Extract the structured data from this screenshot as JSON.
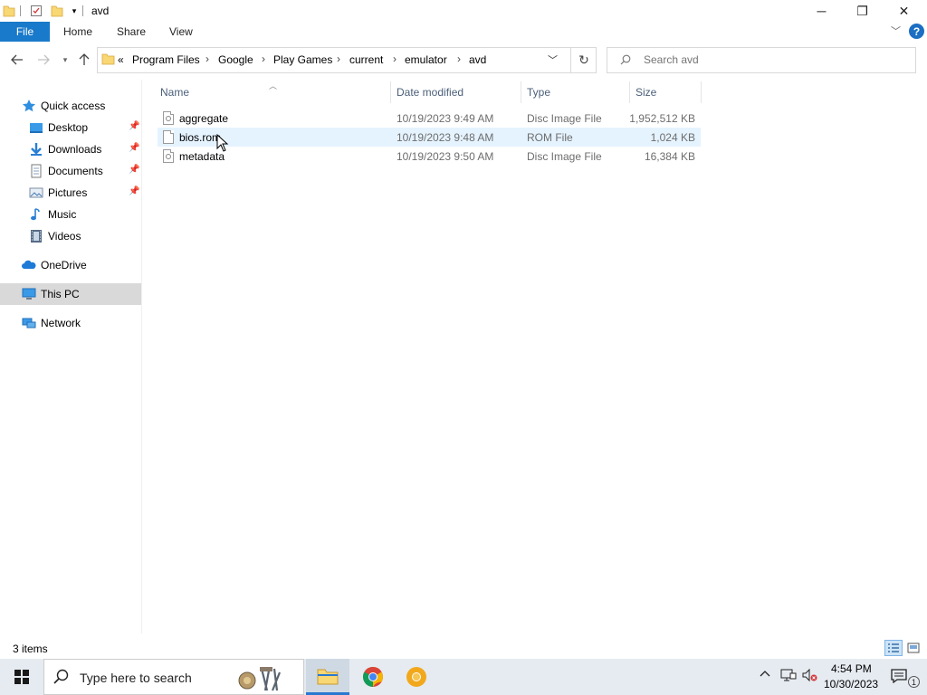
{
  "window": {
    "title": "avd",
    "controls": {
      "minimize": "─",
      "restore": "❐",
      "close": "✕"
    }
  },
  "ribbon": {
    "file": "File",
    "tabs": [
      "Home",
      "Share",
      "View"
    ],
    "help": "?"
  },
  "address": {
    "overflow": "«",
    "crumbs": [
      "Program Files",
      "Google",
      "Play Games",
      "current",
      "emulator",
      "avd"
    ],
    "separator": "›"
  },
  "search": {
    "placeholder": "Search avd"
  },
  "sidebar": {
    "items": [
      {
        "label": "Quick access",
        "icon": "star-icon",
        "pinned": false
      },
      {
        "label": "Desktop",
        "icon": "desktop-icon",
        "pinned": true
      },
      {
        "label": "Downloads",
        "icon": "downloads-icon",
        "pinned": true
      },
      {
        "label": "Documents",
        "icon": "documents-icon",
        "pinned": true
      },
      {
        "label": "Pictures",
        "icon": "pictures-icon",
        "pinned": true
      },
      {
        "label": "Music",
        "icon": "music-icon",
        "pinned": false
      },
      {
        "label": "Videos",
        "icon": "videos-icon",
        "pinned": false
      },
      {
        "label": "OneDrive",
        "icon": "cloud-icon",
        "pinned": false
      },
      {
        "label": "This PC",
        "icon": "computer-icon",
        "pinned": false,
        "selected": true
      },
      {
        "label": "Network",
        "icon": "network-icon",
        "pinned": false
      }
    ]
  },
  "columns": {
    "name": "Name",
    "date": "Date modified",
    "type": "Type",
    "size": "Size"
  },
  "files": [
    {
      "name": "aggregate",
      "date": "10/19/2023 9:49 AM",
      "type": "Disc Image File",
      "size": "1,952,512 KB"
    },
    {
      "name": "bios.rom",
      "date": "10/19/2023 9:48 AM",
      "type": "ROM File",
      "size": "1,024 KB",
      "hover": true
    },
    {
      "name": "metadata",
      "date": "10/19/2023 9:50 AM",
      "type": "Disc Image File",
      "size": "16,384 KB"
    }
  ],
  "status": {
    "count": "3 items"
  },
  "taskbar": {
    "search_placeholder": "Type here to search",
    "time": "4:54 PM",
    "date": "10/30/2023",
    "notification_count": "1"
  },
  "colors": {
    "accent": "#1979ca",
    "selection": "#d9d9d9",
    "hover": "#e5f3ff",
    "folder": "#f8d775"
  }
}
